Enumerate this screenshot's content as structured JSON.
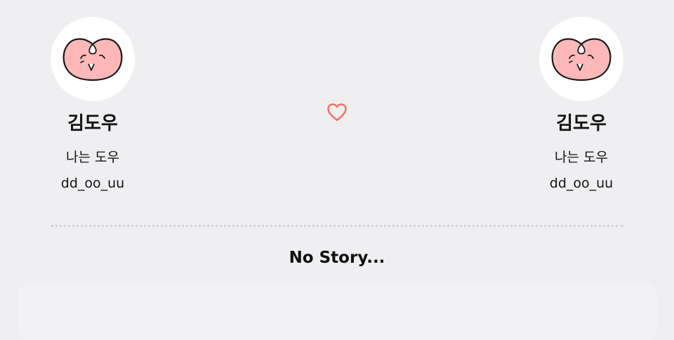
{
  "profiles": [
    {
      "name": "김도우",
      "bio": "나는 도우",
      "handle": "dd_oo_uu",
      "avatar_icon": "peach-face-icon"
    },
    {
      "name": "김도우",
      "bio": "나는 도우",
      "handle": "dd_oo_uu",
      "avatar_icon": "peach-face-icon"
    }
  ],
  "connector": {
    "icon": "heart-outline-icon",
    "color": "#f0735f"
  },
  "story": {
    "empty_text": "No Story..."
  },
  "colors": {
    "background": "#efeff1",
    "avatar_background": "#ffffff",
    "peach_fill": "#ffb8b8",
    "heart": "#f0735f",
    "divider": "#d4d4d8"
  }
}
